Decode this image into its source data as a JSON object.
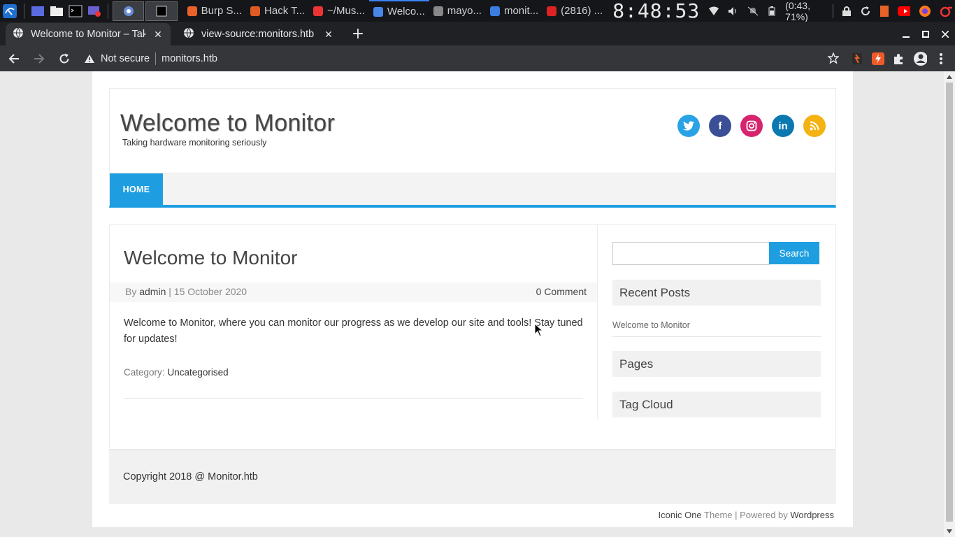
{
  "os": {
    "clock": "8:48:53",
    "battery": "(0:43, 71%)",
    "tasks": [
      {
        "label": "Burp S...",
        "color": "#e8622a"
      },
      {
        "label": "Hack T...",
        "color": "#e05a24"
      },
      {
        "label": "~/Mus...",
        "color": "#e33"
      },
      {
        "label": "Welco...",
        "color": "#4a86e8",
        "active": true
      },
      {
        "label": "mayo...",
        "color": "#888"
      },
      {
        "label": "monit...",
        "color": "#3b7de0"
      },
      {
        "label": "(2816) ...",
        "color": "#d22"
      }
    ]
  },
  "browser": {
    "tabs": [
      {
        "title": "Welcome to Monitor – Tak",
        "active": true
      },
      {
        "title": "view-source:monitors.htb",
        "active": false
      }
    ],
    "not_secure": "Not secure",
    "url": "monitors.htb"
  },
  "site": {
    "title": "Welcome to Monitor",
    "tagline": "Taking hardware monitoring seriously",
    "social": [
      {
        "name": "twitter",
        "color": "#2aa3e6",
        "glyph": ""
      },
      {
        "name": "facebook",
        "color": "#3b4f96",
        "glyph": "f"
      },
      {
        "name": "instagram",
        "color": "#d6246f",
        "glyph": ""
      },
      {
        "name": "linkedin",
        "color": "#0b78b0",
        "glyph": "in"
      },
      {
        "name": "rss",
        "color": "#f5b213",
        "glyph": ""
      }
    ],
    "nav": {
      "home": "HOME"
    },
    "post": {
      "title": "Welcome to Monitor",
      "by_label": "By",
      "author": "admin",
      "separator": "|",
      "date": "15 October 2020",
      "comments": "0 Comment",
      "body": "Welcome to Monitor, where you can monitor our progress as we develop our site and tools! Stay tuned for updates!",
      "category_label": "Category:",
      "category": "Uncategorised"
    },
    "sidebar": {
      "search_button": "Search",
      "search_value": "",
      "recent_posts_title": "Recent Posts",
      "recent_posts": [
        "Welcome to Monitor"
      ],
      "pages_title": "Pages",
      "tag_cloud_title": "Tag Cloud"
    },
    "footer": {
      "copyright": "Copyright 2018 @ Monitor.htb",
      "theme_name": "Iconic One",
      "theme_word": " Theme | Powered by ",
      "powered": "Wordpress"
    }
  }
}
